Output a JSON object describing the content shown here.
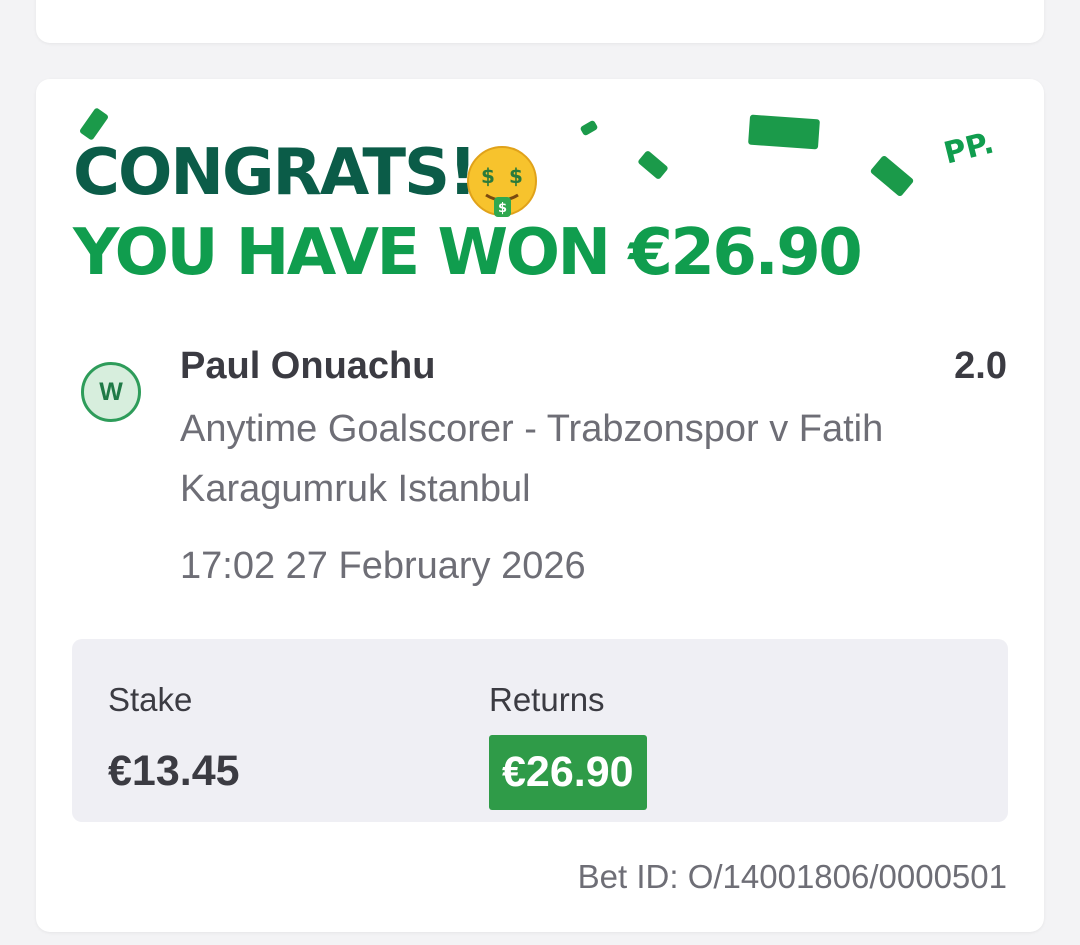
{
  "banner": {
    "congrats": "CONGRATS!",
    "won_text": "YOU HAVE WON €26.90",
    "emoji": "money-mouth-face",
    "logo": "PP."
  },
  "selection": {
    "status": "W",
    "name": "Paul Onuachu",
    "odds": "2.0",
    "market": "Anytime Goalscorer - Trabzonspor v Fatih Karagumruk Istanbul",
    "datetime": "17:02 27 February 2026"
  },
  "summary": {
    "stake_label": "Stake",
    "stake_value": "€13.45",
    "returns_label": "Returns",
    "returns_value": "€26.90"
  },
  "bet_id": "Bet ID: O/14001806/0000501",
  "colors": {
    "dark_green": "#0b5c48",
    "brand_green": "#109d4e",
    "returns_green": "#2f9b48",
    "text": "#3b3b42",
    "muted_text": "#6e6e76",
    "background": "#f3f3f5"
  }
}
